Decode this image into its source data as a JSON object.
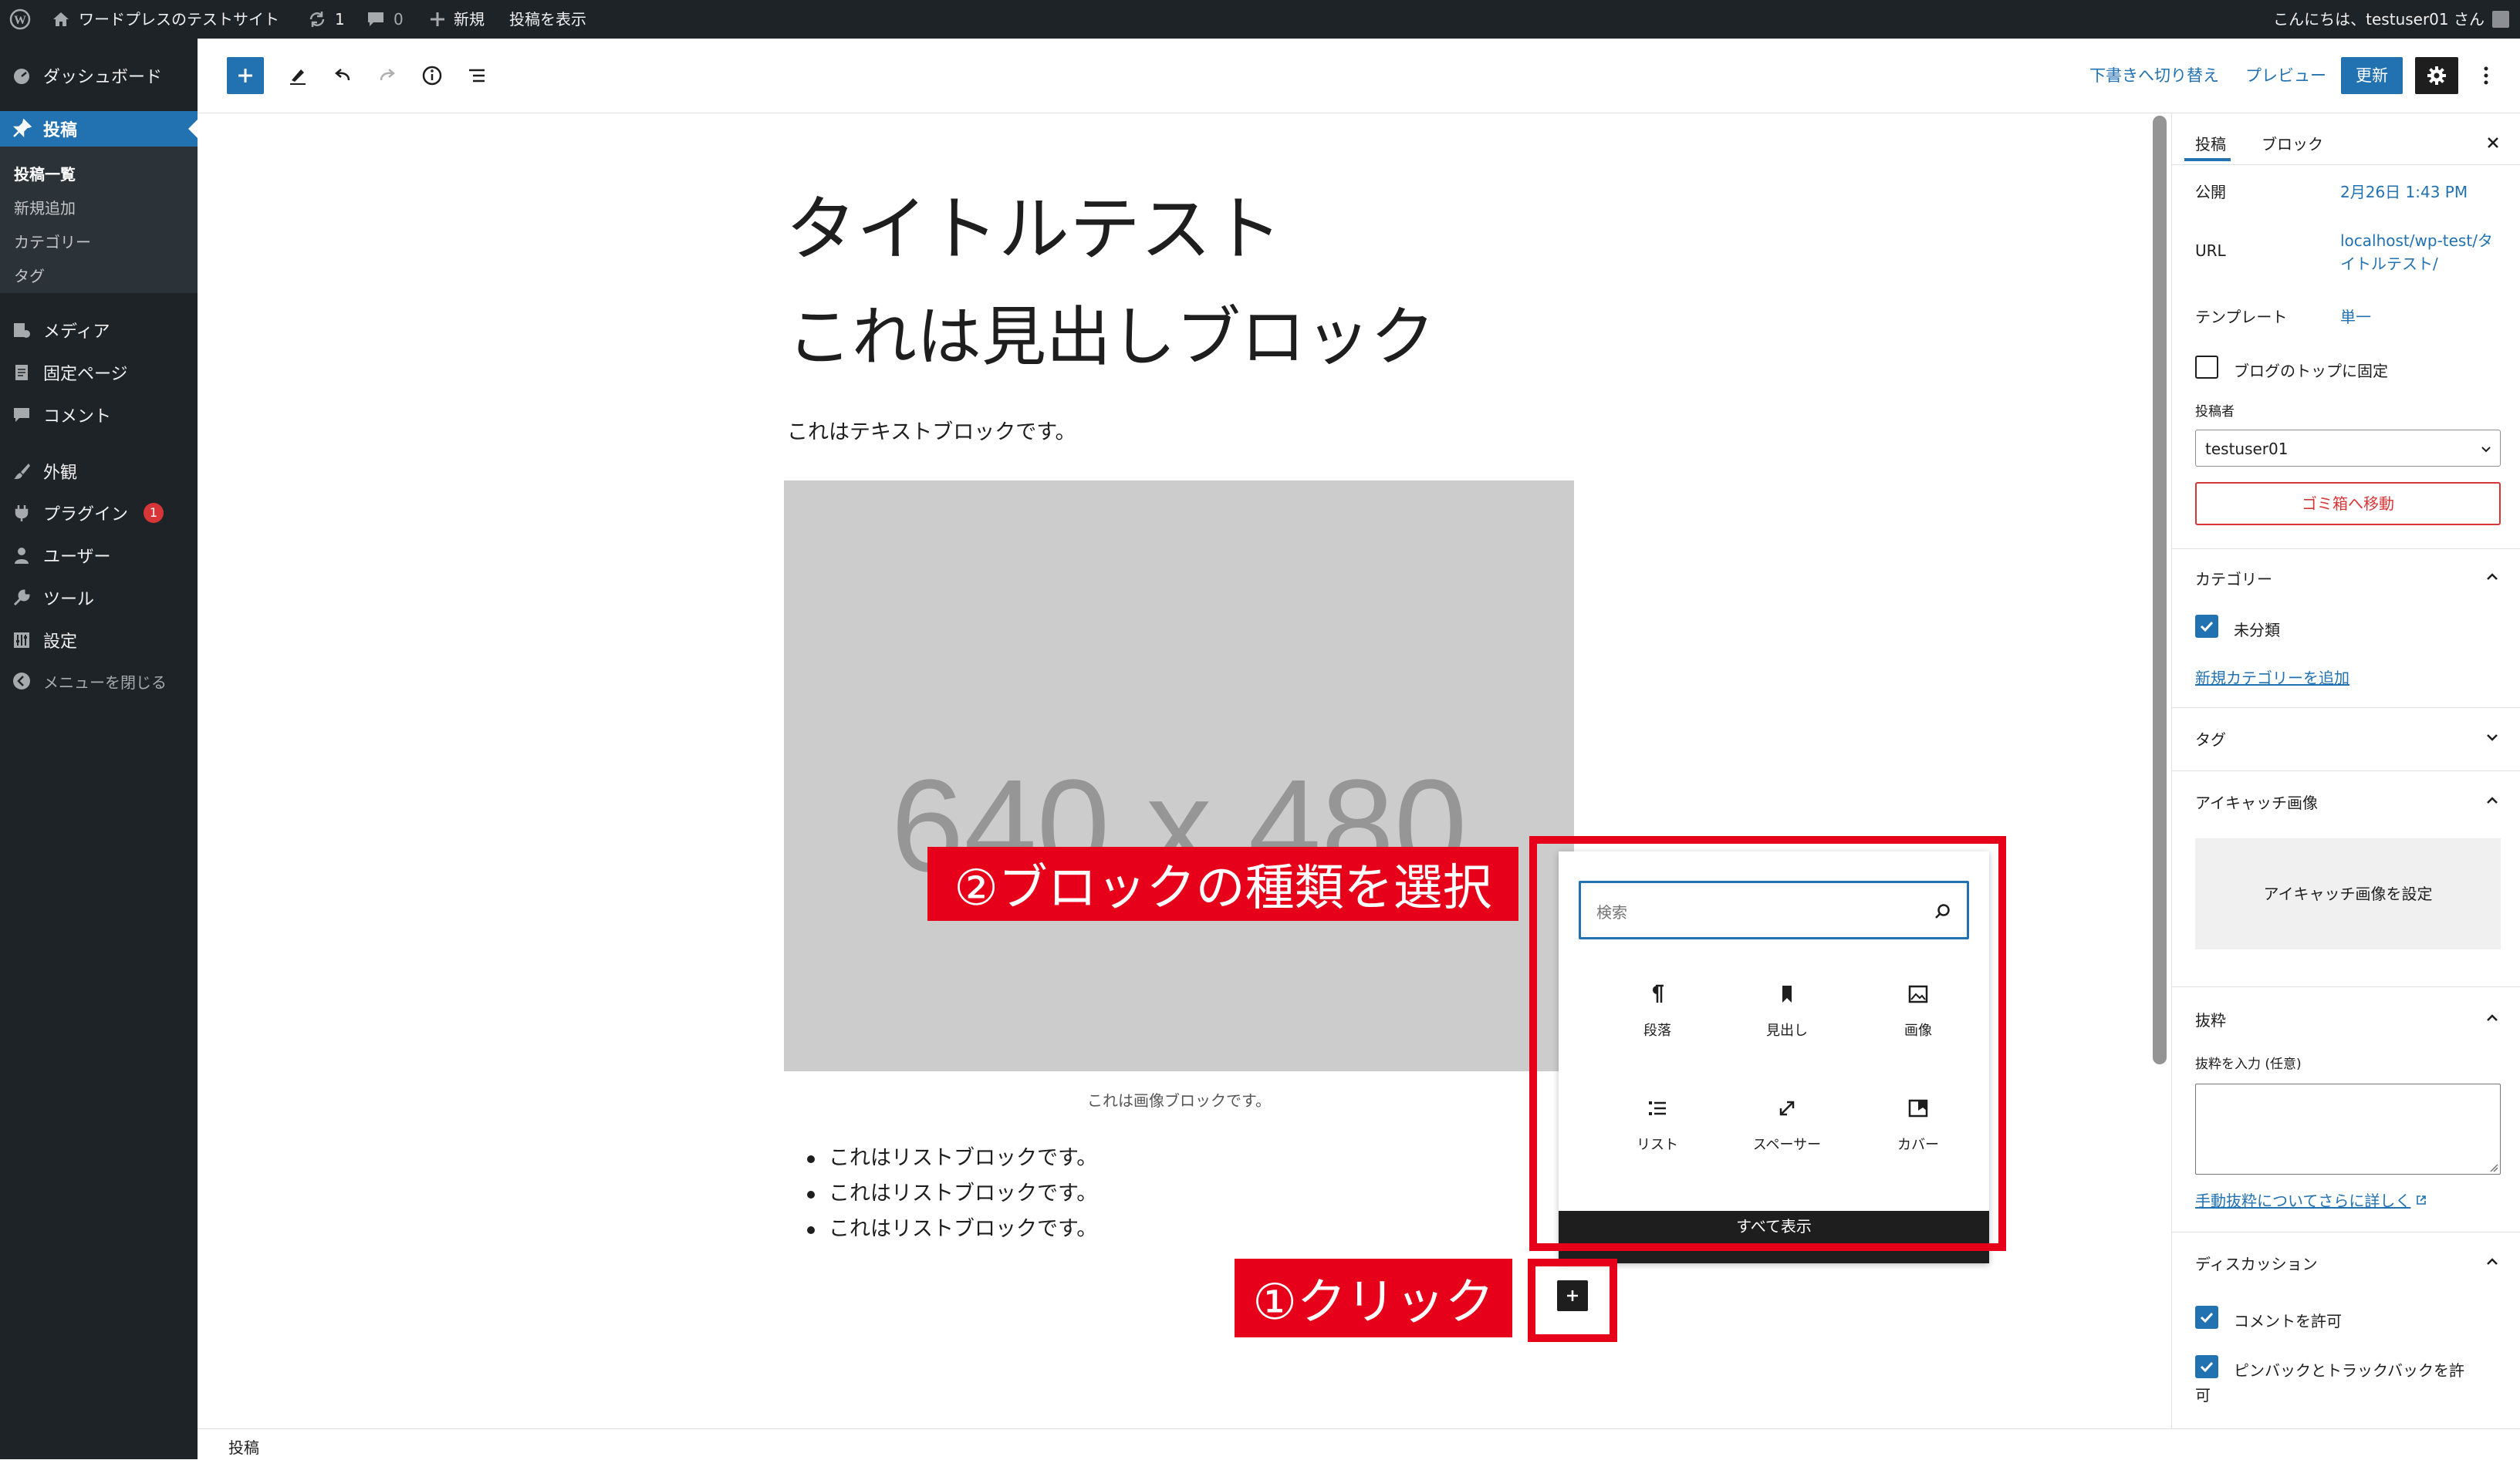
{
  "admin_bar": {
    "site_name": "ワードプレスのテストサイト",
    "updates_count": "1",
    "comments_count": "0",
    "new_label": "新規",
    "view_post": "投稿を表示",
    "greeting": "こんにちは、testuser01 さん"
  },
  "sidebar": {
    "dashboard": "ダッシュボード",
    "posts": "投稿",
    "posts_sub": [
      "投稿一覧",
      "新規追加",
      "カテゴリー",
      "タグ"
    ],
    "media": "メディア",
    "pages": "固定ページ",
    "comments": "コメント",
    "appearance": "外観",
    "plugins": "プラグイン",
    "plugins_badge": "1",
    "users": "ユーザー",
    "tools": "ツール",
    "settings": "設定",
    "collapse": "メニューを閉じる"
  },
  "toolbar": {
    "switch_draft": "下書きへ切り替え",
    "preview": "プレビュー",
    "update": "更新"
  },
  "editor": {
    "title": "タイトルテスト",
    "heading": "これは見出しブロック",
    "paragraph": "これはテキストブロックです。",
    "image_placeholder": "640 x 480",
    "image_caption": "これは画像ブロックです。",
    "list_items": [
      "これはリストブロックです。",
      "これはリストブロックです。",
      "これはリストブロックです。"
    ]
  },
  "inserter": {
    "search_placeholder": "検索",
    "blocks": [
      {
        "label": "段落",
        "icon": "paragraph-icon"
      },
      {
        "label": "見出し",
        "icon": "bookmark-icon"
      },
      {
        "label": "画像",
        "icon": "image-icon"
      },
      {
        "label": "リスト",
        "icon": "list-icon"
      },
      {
        "label": "スペーサー",
        "icon": "resize-icon"
      },
      {
        "label": "カバー",
        "icon": "cover-icon"
      }
    ],
    "browse_all": "すべて表示"
  },
  "annotations": {
    "step1": "①クリック",
    "step2": "②ブロックの種類を選択"
  },
  "inspector": {
    "tabs": [
      "投稿",
      "ブロック"
    ],
    "publish_label": "公開",
    "publish_value": "2月26日 1:43 PM",
    "url_label": "URL",
    "url_value_line1": "localhost/wp-test/タ",
    "url_value_line2": "イトルテスト/",
    "template_label": "テンプレート",
    "template_value": "単一",
    "sticky_label": "ブログのトップに固定",
    "author_label": "投稿者",
    "author_value": "testuser01",
    "trash": "ゴミ箱へ移動",
    "categories_title": "カテゴリー",
    "category_uncategorized": "未分類",
    "add_category": "新規カテゴリーを追加",
    "tags_title": "タグ",
    "featured_title": "アイキャッチ画像",
    "featured_button": "アイキャッチ画像を設定",
    "excerpt_title": "抜粋",
    "excerpt_label": "抜粋を入力 (任意)",
    "excerpt_link": "手動抜粋についてさらに詳しく",
    "discussion_title": "ディスカッション",
    "allow_comments": "コメントを許可",
    "allow_pingbacks_line1": "ピンバックとトラックバックを許",
    "allow_pingbacks_line2": "可"
  },
  "footer": {
    "breadcrumb": "投稿"
  },
  "colors": {
    "admin_dark": "#1d2327",
    "accent": "#2271b1",
    "annotation_red": "#e6001a"
  }
}
